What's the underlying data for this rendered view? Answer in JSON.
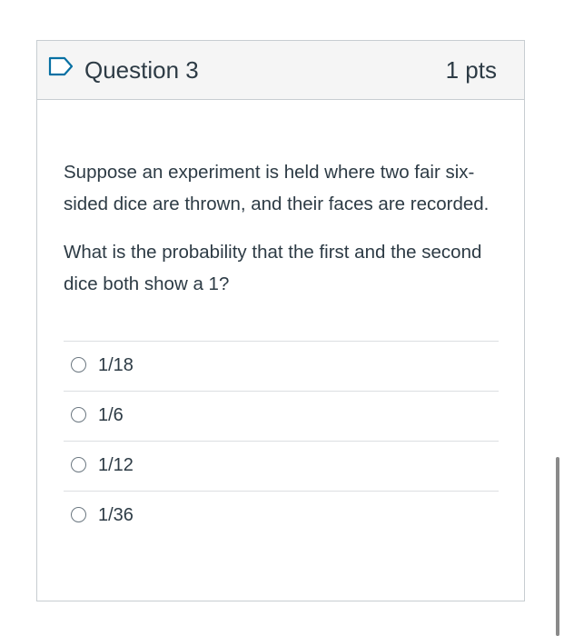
{
  "question": {
    "title": "Question 3",
    "points": "1 pts",
    "flag_icon": "bookmark-flag-icon",
    "paragraphs": [
      "Suppose an experiment is held where two fair six-sided dice are thrown, and their faces are recorded.",
      "What is the probability that the first and the second dice both show a 1?"
    ],
    "answers": [
      {
        "label": "1/18",
        "selected": false
      },
      {
        "label": "1/6",
        "selected": false
      },
      {
        "label": "1/12",
        "selected": false
      },
      {
        "label": "1/36",
        "selected": false
      }
    ]
  },
  "colors": {
    "text": "#2d3b45",
    "header_bg": "#f5f5f5",
    "flag": "#0770a3",
    "border": "#c7cdd1"
  }
}
